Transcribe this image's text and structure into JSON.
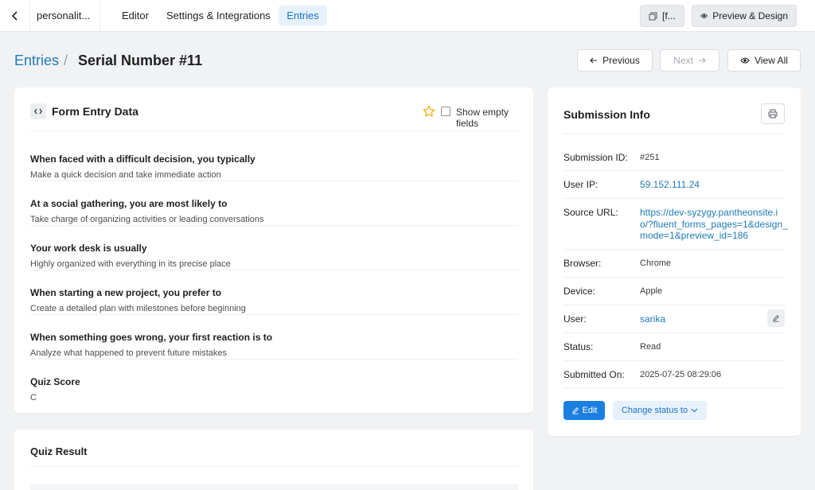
{
  "topbar": {
    "form_name": "personalit...",
    "tabs": [
      {
        "label": "Editor"
      },
      {
        "label": "Settings & Integrations"
      },
      {
        "label": "Entries"
      }
    ],
    "shortcode_label": "[f...",
    "preview_label": "Preview & Design"
  },
  "header": {
    "breadcrumb_link": "Entries",
    "separator": "/",
    "title": "Serial Number #11",
    "previous_label": "Previous",
    "next_label": "Next",
    "view_all_label": "View All"
  },
  "entry": {
    "title": "Form Entry Data",
    "show_empty_label": "Show empty fields",
    "fields": [
      {
        "question": "When faced with a difficult decision, you typically",
        "answer": "Make a quick decision and take immediate action"
      },
      {
        "question": "At a social gathering, you are most likely to",
        "answer": "Take charge of organizing activities or leading conversations"
      },
      {
        "question": "Your work desk is usually",
        "answer": "Highly organized with everything in its precise place"
      },
      {
        "question": "When starting a new project, you prefer to",
        "answer": "Create a detailed plan with milestones before beginning"
      },
      {
        "question": "When something goes wrong, your first reaction is to",
        "answer": "Analyze what happened to prevent future mistakes"
      },
      {
        "question": "Quiz Score",
        "answer": "C"
      }
    ]
  },
  "quiz": {
    "title": "Quiz Result"
  },
  "submission": {
    "title": "Submission Info",
    "rows": [
      {
        "label": "Submission ID:",
        "value": "#251"
      },
      {
        "label": "User IP:",
        "value": "59.152.111.24"
      },
      {
        "label": "Source URL:",
        "value": "https://dev-syzygy.pantheonsite.io/?fluent_forms_pages=1&design_mode=1&preview_id=186"
      },
      {
        "label": "Browser:",
        "value": "Chrome"
      },
      {
        "label": "Device:",
        "value": "Apple"
      },
      {
        "label": "User:",
        "value": "sarika"
      },
      {
        "label": "Status:",
        "value": "Read"
      },
      {
        "label": "Submitted On:",
        "value": "2025-07-25 08:29:06"
      }
    ],
    "edit_label": "Edit",
    "change_status_label": "Change status to"
  },
  "colors": {
    "accent": "#1a7fe0",
    "link": "#1f7ab8",
    "active_tab_bg": "#e7f1fb",
    "star": "#f2b01e"
  }
}
